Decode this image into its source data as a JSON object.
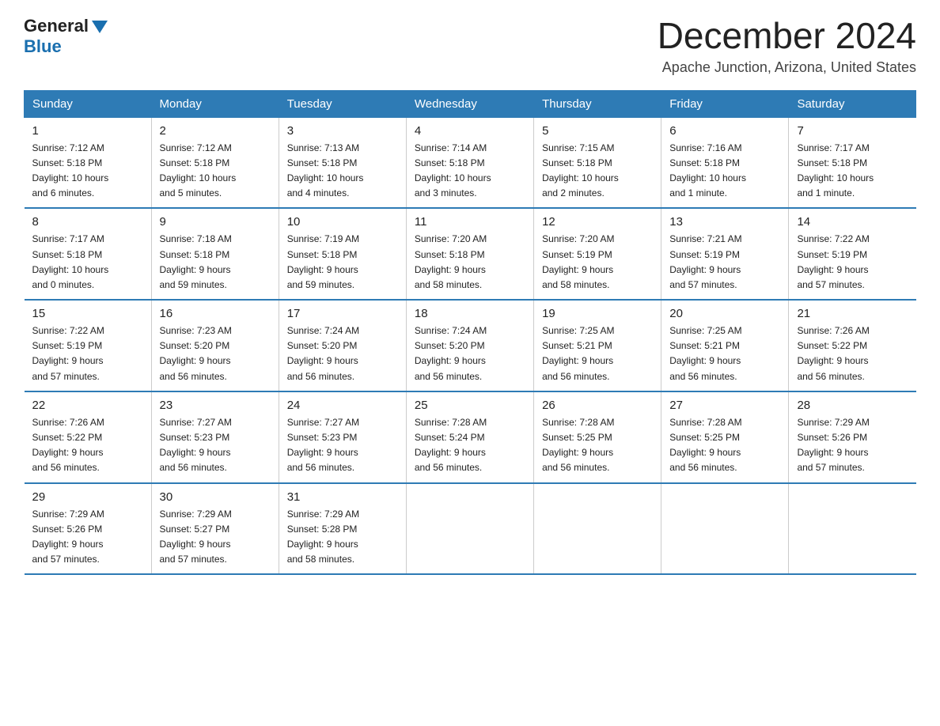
{
  "header": {
    "logo_general": "General",
    "logo_blue": "Blue",
    "month_title": "December 2024",
    "location": "Apache Junction, Arizona, United States"
  },
  "weekdays": [
    "Sunday",
    "Monday",
    "Tuesday",
    "Wednesday",
    "Thursday",
    "Friday",
    "Saturday"
  ],
  "weeks": [
    [
      {
        "day": "1",
        "sunrise": "7:12 AM",
        "sunset": "5:18 PM",
        "daylight": "10 hours and 6 minutes."
      },
      {
        "day": "2",
        "sunrise": "7:12 AM",
        "sunset": "5:18 PM",
        "daylight": "10 hours and 5 minutes."
      },
      {
        "day": "3",
        "sunrise": "7:13 AM",
        "sunset": "5:18 PM",
        "daylight": "10 hours and 4 minutes."
      },
      {
        "day": "4",
        "sunrise": "7:14 AM",
        "sunset": "5:18 PM",
        "daylight": "10 hours and 3 minutes."
      },
      {
        "day": "5",
        "sunrise": "7:15 AM",
        "sunset": "5:18 PM",
        "daylight": "10 hours and 2 minutes."
      },
      {
        "day": "6",
        "sunrise": "7:16 AM",
        "sunset": "5:18 PM",
        "daylight": "10 hours and 1 minute."
      },
      {
        "day": "7",
        "sunrise": "7:17 AM",
        "sunset": "5:18 PM",
        "daylight": "10 hours and 1 minute."
      }
    ],
    [
      {
        "day": "8",
        "sunrise": "7:17 AM",
        "sunset": "5:18 PM",
        "daylight": "10 hours and 0 minutes."
      },
      {
        "day": "9",
        "sunrise": "7:18 AM",
        "sunset": "5:18 PM",
        "daylight": "9 hours and 59 minutes."
      },
      {
        "day": "10",
        "sunrise": "7:19 AM",
        "sunset": "5:18 PM",
        "daylight": "9 hours and 59 minutes."
      },
      {
        "day": "11",
        "sunrise": "7:20 AM",
        "sunset": "5:18 PM",
        "daylight": "9 hours and 58 minutes."
      },
      {
        "day": "12",
        "sunrise": "7:20 AM",
        "sunset": "5:19 PM",
        "daylight": "9 hours and 58 minutes."
      },
      {
        "day": "13",
        "sunrise": "7:21 AM",
        "sunset": "5:19 PM",
        "daylight": "9 hours and 57 minutes."
      },
      {
        "day": "14",
        "sunrise": "7:22 AM",
        "sunset": "5:19 PM",
        "daylight": "9 hours and 57 minutes."
      }
    ],
    [
      {
        "day": "15",
        "sunrise": "7:22 AM",
        "sunset": "5:19 PM",
        "daylight": "9 hours and 57 minutes."
      },
      {
        "day": "16",
        "sunrise": "7:23 AM",
        "sunset": "5:20 PM",
        "daylight": "9 hours and 56 minutes."
      },
      {
        "day": "17",
        "sunrise": "7:24 AM",
        "sunset": "5:20 PM",
        "daylight": "9 hours and 56 minutes."
      },
      {
        "day": "18",
        "sunrise": "7:24 AM",
        "sunset": "5:20 PM",
        "daylight": "9 hours and 56 minutes."
      },
      {
        "day": "19",
        "sunrise": "7:25 AM",
        "sunset": "5:21 PM",
        "daylight": "9 hours and 56 minutes."
      },
      {
        "day": "20",
        "sunrise": "7:25 AM",
        "sunset": "5:21 PM",
        "daylight": "9 hours and 56 minutes."
      },
      {
        "day": "21",
        "sunrise": "7:26 AM",
        "sunset": "5:22 PM",
        "daylight": "9 hours and 56 minutes."
      }
    ],
    [
      {
        "day": "22",
        "sunrise": "7:26 AM",
        "sunset": "5:22 PM",
        "daylight": "9 hours and 56 minutes."
      },
      {
        "day": "23",
        "sunrise": "7:27 AM",
        "sunset": "5:23 PM",
        "daylight": "9 hours and 56 minutes."
      },
      {
        "day": "24",
        "sunrise": "7:27 AM",
        "sunset": "5:23 PM",
        "daylight": "9 hours and 56 minutes."
      },
      {
        "day": "25",
        "sunrise": "7:28 AM",
        "sunset": "5:24 PM",
        "daylight": "9 hours and 56 minutes."
      },
      {
        "day": "26",
        "sunrise": "7:28 AM",
        "sunset": "5:25 PM",
        "daylight": "9 hours and 56 minutes."
      },
      {
        "day": "27",
        "sunrise": "7:28 AM",
        "sunset": "5:25 PM",
        "daylight": "9 hours and 56 minutes."
      },
      {
        "day": "28",
        "sunrise": "7:29 AM",
        "sunset": "5:26 PM",
        "daylight": "9 hours and 57 minutes."
      }
    ],
    [
      {
        "day": "29",
        "sunrise": "7:29 AM",
        "sunset": "5:26 PM",
        "daylight": "9 hours and 57 minutes."
      },
      {
        "day": "30",
        "sunrise": "7:29 AM",
        "sunset": "5:27 PM",
        "daylight": "9 hours and 57 minutes."
      },
      {
        "day": "31",
        "sunrise": "7:29 AM",
        "sunset": "5:28 PM",
        "daylight": "9 hours and 58 minutes."
      },
      null,
      null,
      null,
      null
    ]
  ]
}
